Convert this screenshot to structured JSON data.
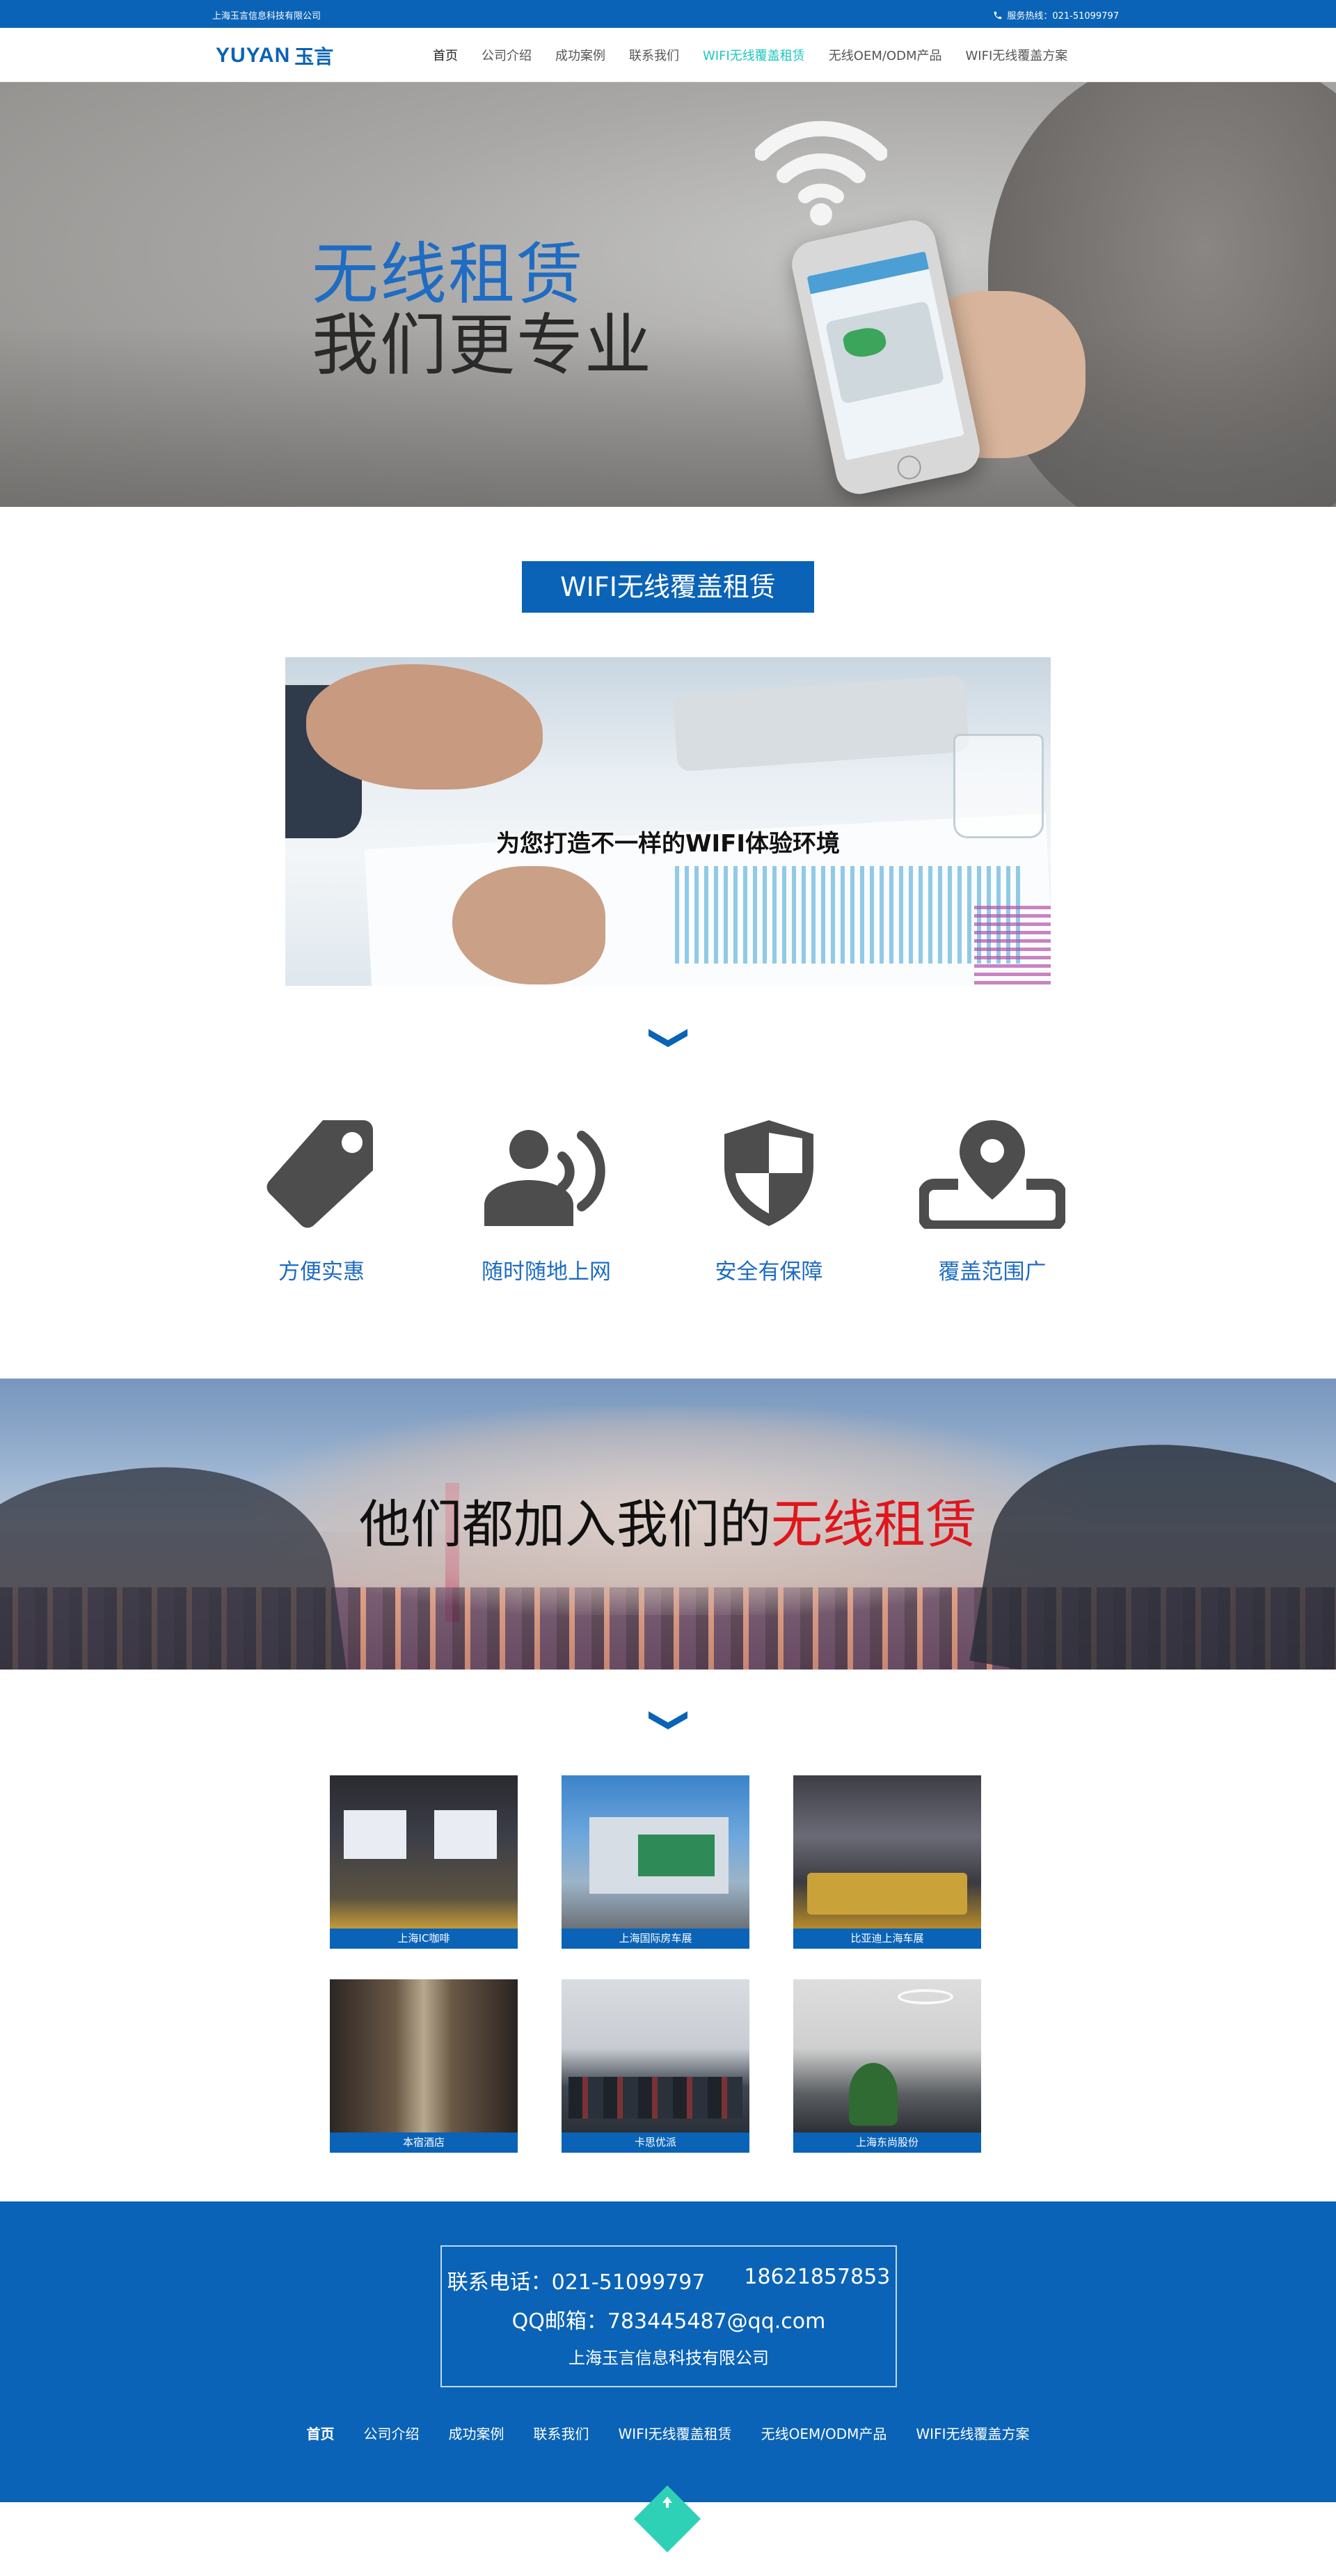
{
  "topbar": {
    "company": "上海玉言信息科技有限公司",
    "hotline": "服务热线：021-51099797"
  },
  "logo": {
    "en": "YUYAN",
    "cn": "玉言"
  },
  "nav": {
    "items": [
      {
        "label": "首页"
      },
      {
        "label": "公司介绍"
      },
      {
        "label": "成功案例"
      },
      {
        "label": "联系我们"
      },
      {
        "label": "WIFI无线覆盖租赁"
      },
      {
        "label": "无线OEM/ODM产品"
      },
      {
        "label": "WIFI无线覆盖方案"
      }
    ],
    "active_color": "#1fc6c0"
  },
  "hero": {
    "title_line1": "无线租赁",
    "title_line2": "我们更专业",
    "icon": "wifi-icon"
  },
  "section": {
    "badge": "WIFI无线覆盖租赁",
    "feature_caption": "为您打造不一样的WIFI体验环境"
  },
  "features": [
    {
      "label": "方便实惠",
      "icon": "price-tag-icon"
    },
    {
      "label": "随时随地上网",
      "icon": "user-broadcast-icon"
    },
    {
      "label": "安全有保障",
      "icon": "shield-icon"
    },
    {
      "label": "覆盖范围广",
      "icon": "location-pin-icon"
    }
  ],
  "banner": {
    "text_black": "他们都加入我们的",
    "text_red": "无线租赁"
  },
  "cases": [
    {
      "caption": "上海IC咖啡"
    },
    {
      "caption": "上海国际房车展"
    },
    {
      "caption": "比亚迪上海车展"
    },
    {
      "caption": "本宿酒店"
    },
    {
      "caption": "卡思优派"
    },
    {
      "caption": "上海东尚股份"
    }
  ],
  "footer": {
    "phone_label": "联系电话：021-51099797",
    "mobile": "18621857853",
    "qq": "QQ邮箱：783445487@qq.com",
    "company": "上海玉言信息科技有限公司",
    "menu": [
      {
        "label": "首页"
      },
      {
        "label": "公司介绍"
      },
      {
        "label": "成功案例"
      },
      {
        "label": "联系我们"
      },
      {
        "label": "WIFI无线覆盖租赁"
      },
      {
        "label": "无线OEM/ODM产品"
      },
      {
        "label": "WIFI无线覆盖方案"
      }
    ]
  },
  "colors": {
    "brand_blue": "#0a63b6",
    "accent_teal": "#1fc6c0",
    "highlight_red": "#e0161d",
    "icon_gray": "#4d4d4d"
  }
}
